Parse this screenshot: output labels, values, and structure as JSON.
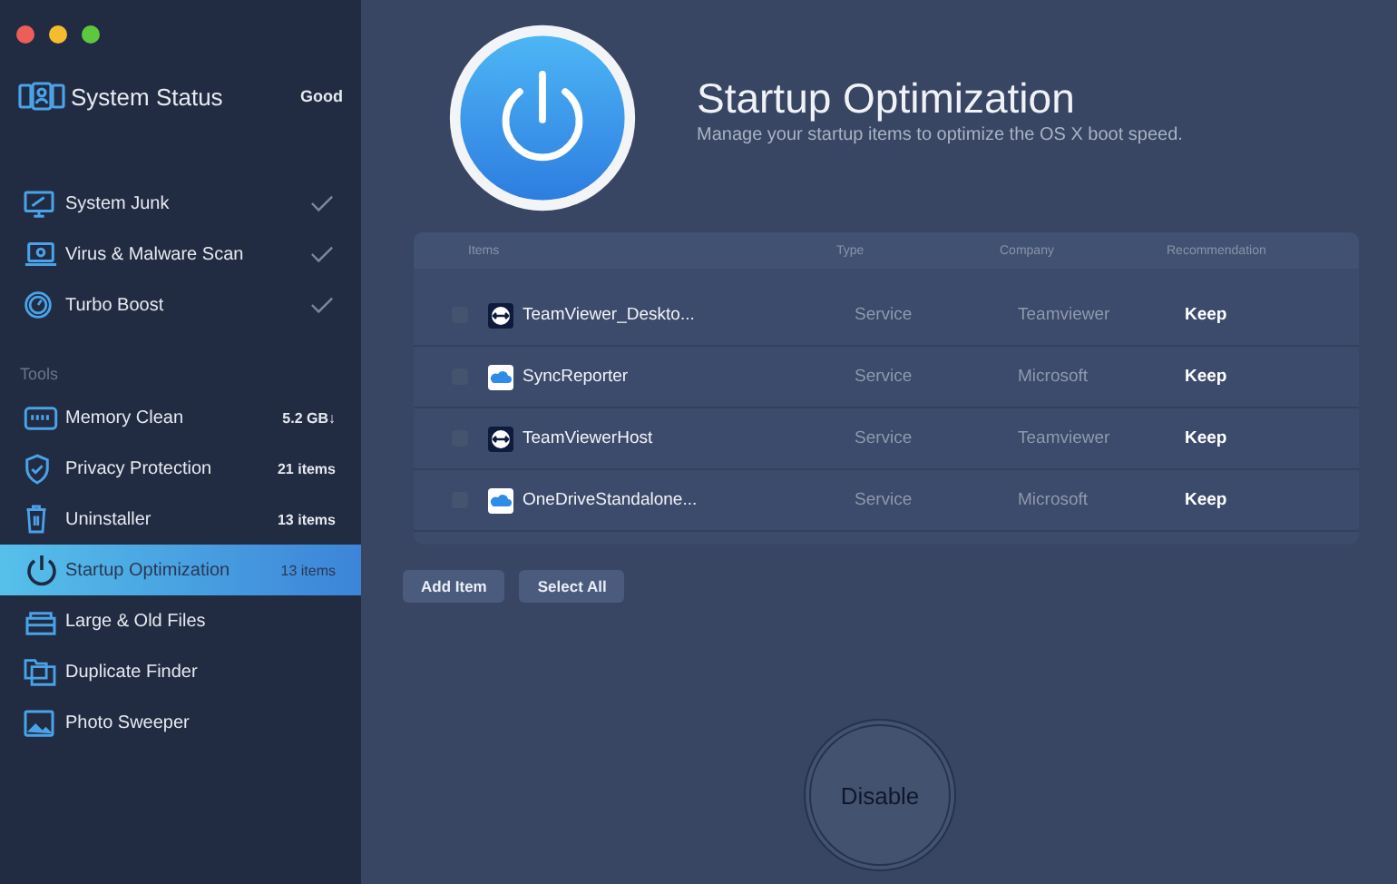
{
  "sidebar": {
    "status": {
      "title": "System Status",
      "value": "Good"
    },
    "scans": [
      {
        "label": "System Junk",
        "done": true
      },
      {
        "label": "Virus & Malware Scan",
        "done": true
      },
      {
        "label": "Turbo Boost",
        "done": true
      }
    ],
    "tools_heading": "Tools",
    "tools": [
      {
        "label": "Memory Clean",
        "count": "5.2 GB↓",
        "selected": false
      },
      {
        "label": "Privacy Protection",
        "count": "21 items",
        "selected": false
      },
      {
        "label": "Uninstaller",
        "count": "13 items",
        "selected": false
      },
      {
        "label": "Startup Optimization",
        "count": "13 items",
        "selected": true
      },
      {
        "label": "Large & Old Files",
        "selected": false
      },
      {
        "label": "Duplicate Finder",
        "selected": false
      },
      {
        "label": "Photo Sweeper",
        "selected": false
      }
    ]
  },
  "header": {
    "title": "Startup Optimization",
    "subtitle": "Manage your startup items to optimize the OS X boot speed."
  },
  "table": {
    "columns": [
      "Items",
      "Type",
      "Company",
      "Recommendation"
    ],
    "rows": [
      {
        "kind": "teamviewer",
        "checked": false,
        "name": "TeamViewer_Deskto...",
        "type": "Service",
        "company": "Teamviewer",
        "recommendation": "Keep"
      },
      {
        "kind": "cloud",
        "checked": false,
        "name": "SyncReporter",
        "type": "Service",
        "company": "Microsoft",
        "recommendation": "Keep"
      },
      {
        "kind": "teamviewer",
        "checked": false,
        "name": "TeamViewerHost",
        "type": "Service",
        "company": "Teamviewer",
        "recommendation": "Keep"
      },
      {
        "kind": "cloud",
        "checked": false,
        "name": "OneDriveStandalone...",
        "type": "Service",
        "company": "Microsoft",
        "recommendation": "Keep"
      }
    ]
  },
  "buttons": [
    "Add Item",
    "Select All"
  ],
  "action": {
    "label": "Disable",
    "disabled": true
  }
}
